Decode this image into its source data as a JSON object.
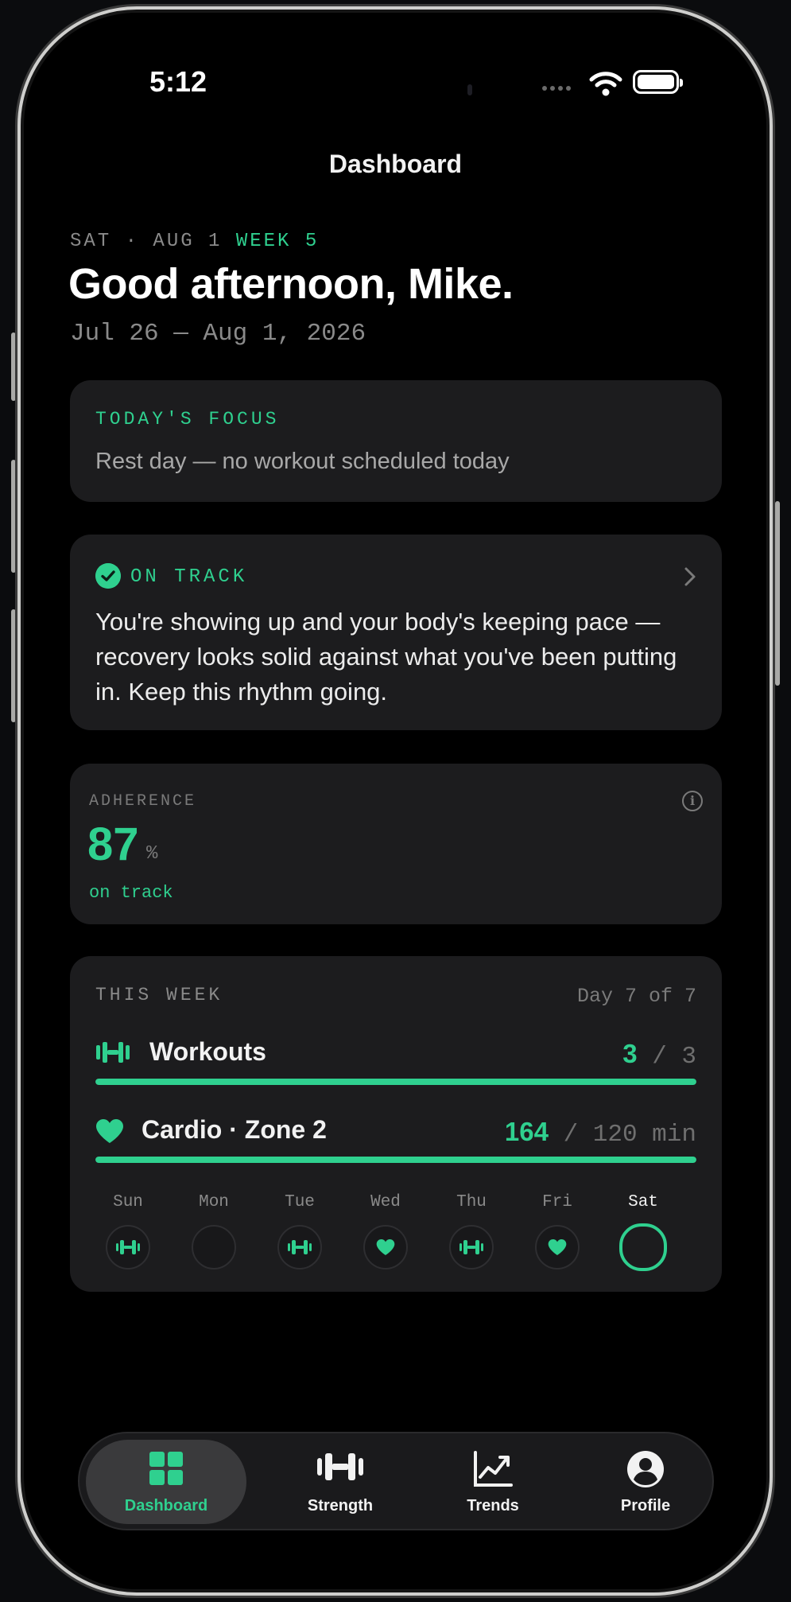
{
  "status_bar": {
    "time": "5:12"
  },
  "nav": {
    "title": "Dashboard"
  },
  "header": {
    "date_prefix": "SAT · AUG 1",
    "week_label": "WEEK 5",
    "greeting": "Good afternoon, Mike.",
    "date_range": "Jul 26 — Aug 1, 2026"
  },
  "focus": {
    "label": "TODAY'S FOCUS",
    "text": "Rest day — no workout scheduled today"
  },
  "status_card": {
    "label": "ON TRACK",
    "message": "You're showing up and your body's keeping pace — recovery looks solid against what you've been putting in. Keep this rhythm going."
  },
  "adherence": {
    "label": "ADHERENCE",
    "value": "87",
    "unit": "%",
    "status": "on track"
  },
  "week": {
    "label": "THIS WEEK",
    "day_of": "Day 7 of 7",
    "workouts": {
      "label": "Workouts",
      "done": "3",
      "separator": "/ 3",
      "progress": 1.0
    },
    "cardio": {
      "label": "Cardio · Zone 2",
      "done": "164",
      "separator": "/ 120 min",
      "progress": 1.0
    },
    "days": [
      {
        "name": "Sun",
        "activity": "strength"
      },
      {
        "name": "Mon",
        "activity": "none"
      },
      {
        "name": "Tue",
        "activity": "strength"
      },
      {
        "name": "Wed",
        "activity": "cardio"
      },
      {
        "name": "Thu",
        "activity": "strength"
      },
      {
        "name": "Fri",
        "activity": "cardio"
      },
      {
        "name": "Sat",
        "activity": "today"
      }
    ]
  },
  "tabbar": {
    "tabs": [
      {
        "label": "Dashboard",
        "icon": "grid-icon",
        "active": true
      },
      {
        "label": "Strength",
        "icon": "dumbbell-icon",
        "active": false
      },
      {
        "label": "Trends",
        "icon": "trend-chart-icon",
        "active": false
      },
      {
        "label": "Profile",
        "icon": "profile-icon",
        "active": false
      }
    ]
  },
  "colors": {
    "accent": "#2fd08f",
    "card": "#1c1c1e",
    "background": "#000000"
  }
}
